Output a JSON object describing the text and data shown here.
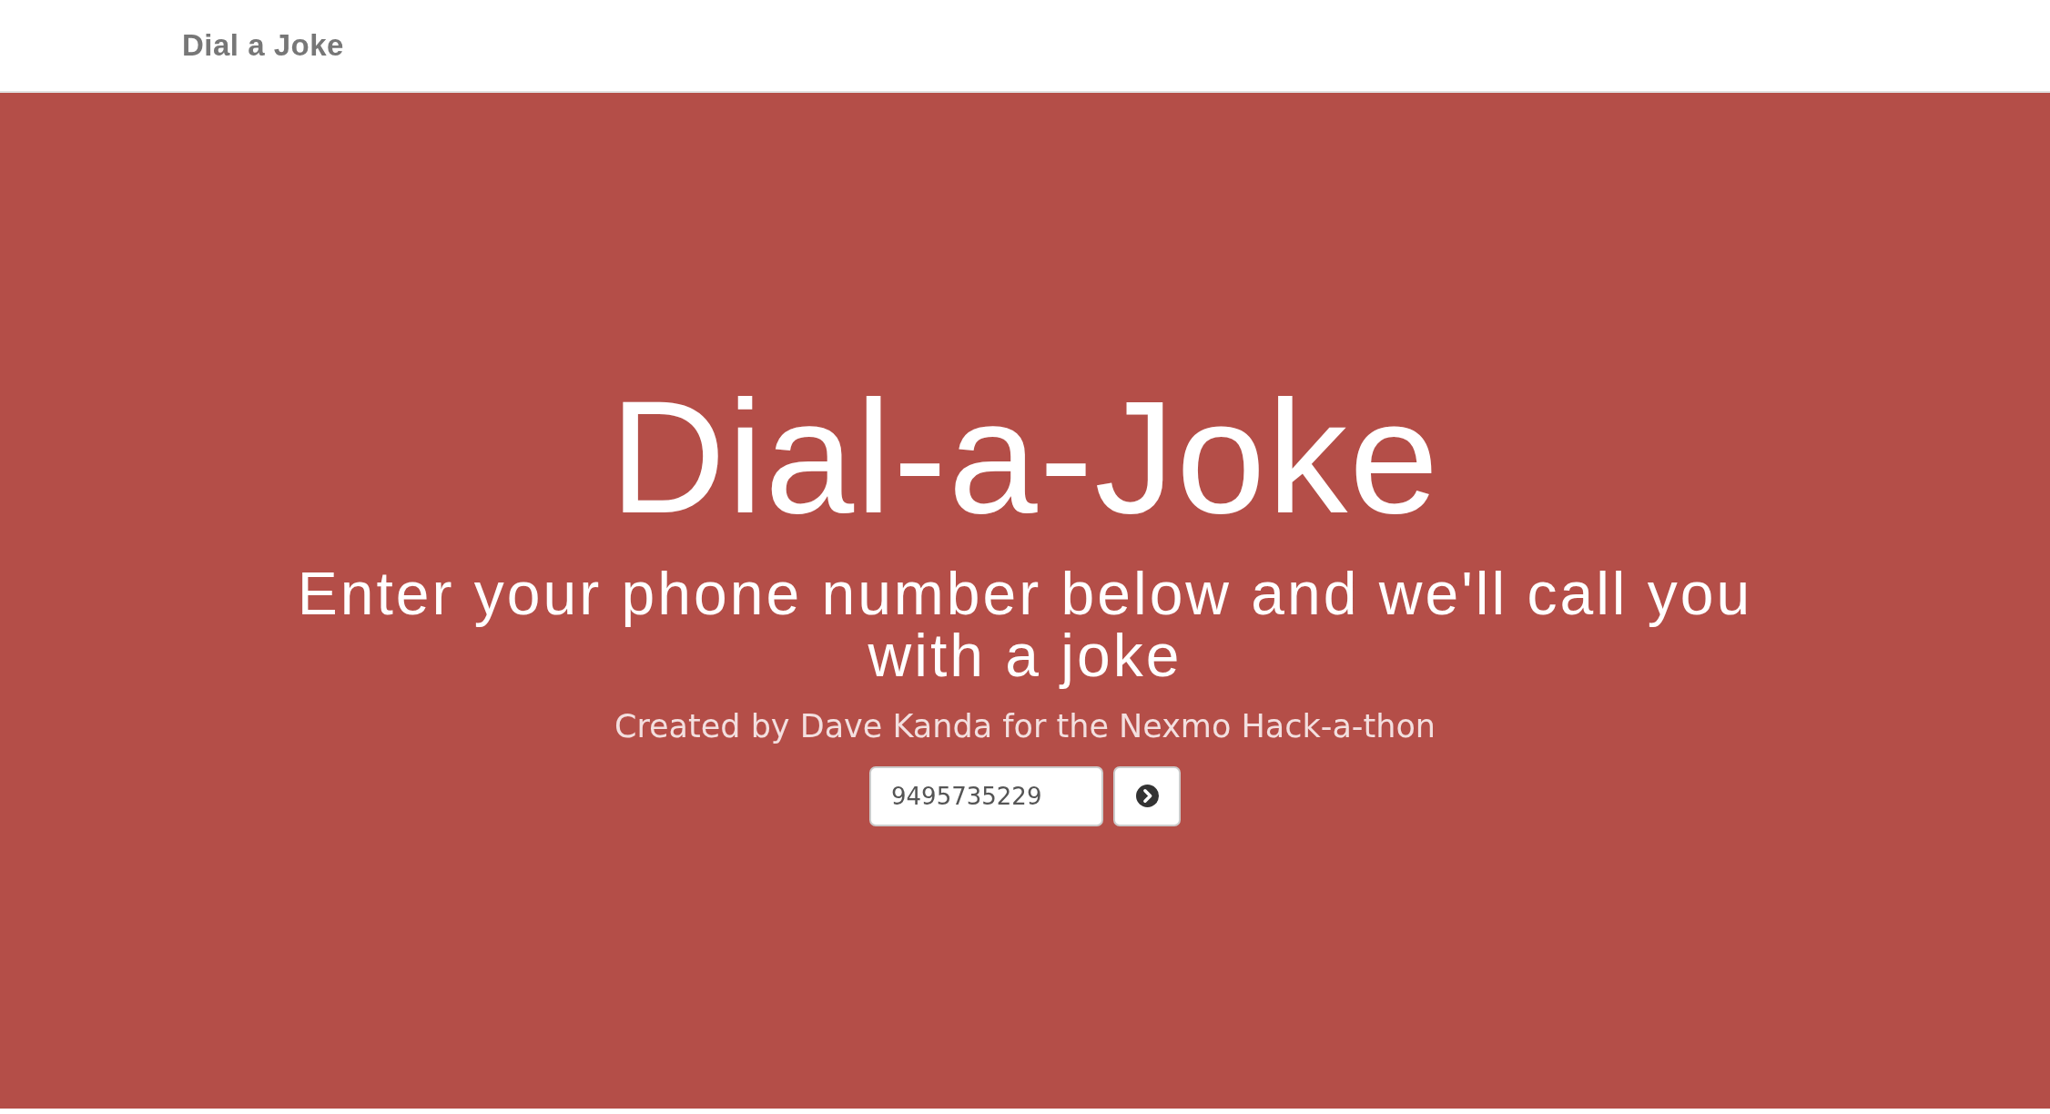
{
  "navbar": {
    "brand": "Dial a Joke"
  },
  "hero": {
    "title": "Dial-a-Joke",
    "subtitle": "Enter your phone number below and we'll call you with a joke",
    "credit": "Created by Dave Kanda for the Nexmo Hack-a-thon",
    "phone_field": {
      "value": "9495735229"
    }
  }
}
